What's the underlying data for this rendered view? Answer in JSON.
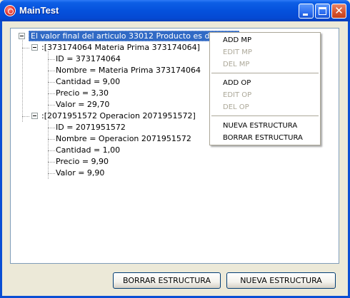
{
  "window": {
    "title": "MainTest"
  },
  "tree": {
    "root": "El valor final del articulo 33012 Producto es de 40 €.",
    "groups": [
      {
        "label": ":[373174064 Materia Prima 373174064]",
        "items": [
          "ID = 373174064",
          "Nombre = Materia Prima 373174064",
          "Cantidad = 9,00",
          "Precio = 3,30",
          "Valor = 29,70"
        ]
      },
      {
        "label": ":[2071951572 Operacion 2071951572]",
        "items": [
          "ID = 2071951572",
          "Nombre = Operacion 2071951572",
          "Cantidad = 1,00",
          "Precio = 9,90",
          "Valor = 9,90"
        ]
      }
    ]
  },
  "context_menu": {
    "add_mp": "ADD MP",
    "edit_mp": "EDIT MP",
    "del_mp": "DEL MP",
    "add_op": "ADD OP",
    "edit_op": "EDIT OP",
    "del_op": "DEL OP",
    "nueva": "NUEVA ESTRUCTURA",
    "borrar": "BORRAR ESTRUCTURA"
  },
  "buttons": {
    "borrar": "BORRAR ESTRUCTURA",
    "nueva": "NUEVA ESTRUCTURA"
  },
  "colors": {
    "titlebar": "#0551dc",
    "selection": "#316ac5",
    "disabled_text": "#aca899"
  }
}
